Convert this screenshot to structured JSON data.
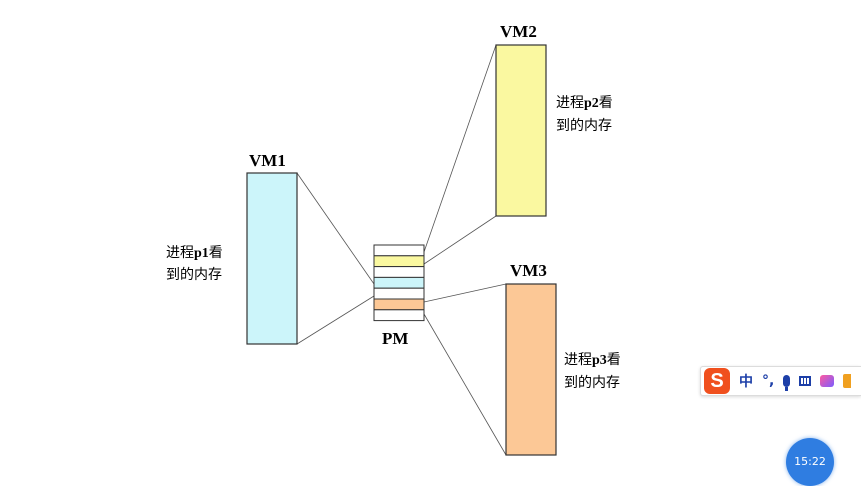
{
  "vm1": {
    "title": "VM1",
    "caption_prefix": "进程",
    "caption_bold": "p1",
    "caption_suffix": "看",
    "caption_line2": "到的内存",
    "color": "#ccf5fa"
  },
  "vm2": {
    "title": "VM2",
    "caption_prefix": "进程",
    "caption_bold": "p2",
    "caption_suffix": "看",
    "caption_line2": "到的内存",
    "color": "#faf8a0"
  },
  "vm3": {
    "title": "VM3",
    "caption_prefix": "进程",
    "caption_bold": "p3",
    "caption_suffix": "看",
    "caption_line2": "到的内存",
    "color": "#fcc896"
  },
  "pm": {
    "title": "PM",
    "segments": [
      "#ffffff",
      "#faf8a0",
      "#ffffff",
      "#ccf5fa",
      "#ffffff",
      "#fcc896",
      "#ffffff"
    ]
  },
  "ime": {
    "logo": "S",
    "mode_label": "中",
    "punct_label": "°,",
    "icons": [
      "logo-icon",
      "mic-icon",
      "keyboard-icon",
      "skin-icon",
      "more-icon"
    ]
  },
  "clock": {
    "time": "15:22"
  }
}
